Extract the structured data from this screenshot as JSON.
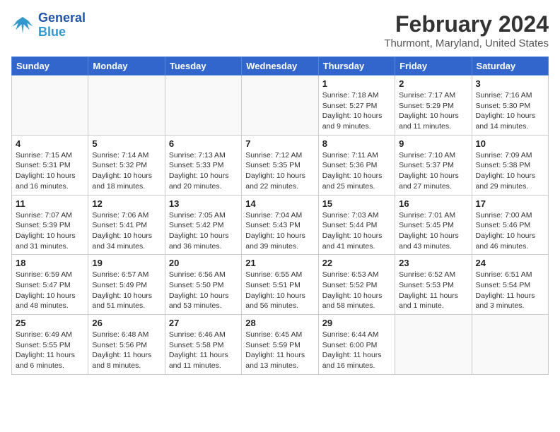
{
  "logo": {
    "text_general": "General",
    "text_blue": "Blue"
  },
  "header": {
    "month": "February 2024",
    "location": "Thurmont, Maryland, United States"
  },
  "days_of_week": [
    "Sunday",
    "Monday",
    "Tuesday",
    "Wednesday",
    "Thursday",
    "Friday",
    "Saturday"
  ],
  "weeks": [
    [
      {
        "day": "",
        "info": ""
      },
      {
        "day": "",
        "info": ""
      },
      {
        "day": "",
        "info": ""
      },
      {
        "day": "",
        "info": ""
      },
      {
        "day": "1",
        "info": "Sunrise: 7:18 AM\nSunset: 5:27 PM\nDaylight: 10 hours\nand 9 minutes."
      },
      {
        "day": "2",
        "info": "Sunrise: 7:17 AM\nSunset: 5:29 PM\nDaylight: 10 hours\nand 11 minutes."
      },
      {
        "day": "3",
        "info": "Sunrise: 7:16 AM\nSunset: 5:30 PM\nDaylight: 10 hours\nand 14 minutes."
      }
    ],
    [
      {
        "day": "4",
        "info": "Sunrise: 7:15 AM\nSunset: 5:31 PM\nDaylight: 10 hours\nand 16 minutes."
      },
      {
        "day": "5",
        "info": "Sunrise: 7:14 AM\nSunset: 5:32 PM\nDaylight: 10 hours\nand 18 minutes."
      },
      {
        "day": "6",
        "info": "Sunrise: 7:13 AM\nSunset: 5:33 PM\nDaylight: 10 hours\nand 20 minutes."
      },
      {
        "day": "7",
        "info": "Sunrise: 7:12 AM\nSunset: 5:35 PM\nDaylight: 10 hours\nand 22 minutes."
      },
      {
        "day": "8",
        "info": "Sunrise: 7:11 AM\nSunset: 5:36 PM\nDaylight: 10 hours\nand 25 minutes."
      },
      {
        "day": "9",
        "info": "Sunrise: 7:10 AM\nSunset: 5:37 PM\nDaylight: 10 hours\nand 27 minutes."
      },
      {
        "day": "10",
        "info": "Sunrise: 7:09 AM\nSunset: 5:38 PM\nDaylight: 10 hours\nand 29 minutes."
      }
    ],
    [
      {
        "day": "11",
        "info": "Sunrise: 7:07 AM\nSunset: 5:39 PM\nDaylight: 10 hours\nand 31 minutes."
      },
      {
        "day": "12",
        "info": "Sunrise: 7:06 AM\nSunset: 5:41 PM\nDaylight: 10 hours\nand 34 minutes."
      },
      {
        "day": "13",
        "info": "Sunrise: 7:05 AM\nSunset: 5:42 PM\nDaylight: 10 hours\nand 36 minutes."
      },
      {
        "day": "14",
        "info": "Sunrise: 7:04 AM\nSunset: 5:43 PM\nDaylight: 10 hours\nand 39 minutes."
      },
      {
        "day": "15",
        "info": "Sunrise: 7:03 AM\nSunset: 5:44 PM\nDaylight: 10 hours\nand 41 minutes."
      },
      {
        "day": "16",
        "info": "Sunrise: 7:01 AM\nSunset: 5:45 PM\nDaylight: 10 hours\nand 43 minutes."
      },
      {
        "day": "17",
        "info": "Sunrise: 7:00 AM\nSunset: 5:46 PM\nDaylight: 10 hours\nand 46 minutes."
      }
    ],
    [
      {
        "day": "18",
        "info": "Sunrise: 6:59 AM\nSunset: 5:47 PM\nDaylight: 10 hours\nand 48 minutes."
      },
      {
        "day": "19",
        "info": "Sunrise: 6:57 AM\nSunset: 5:49 PM\nDaylight: 10 hours\nand 51 minutes."
      },
      {
        "day": "20",
        "info": "Sunrise: 6:56 AM\nSunset: 5:50 PM\nDaylight: 10 hours\nand 53 minutes."
      },
      {
        "day": "21",
        "info": "Sunrise: 6:55 AM\nSunset: 5:51 PM\nDaylight: 10 hours\nand 56 minutes."
      },
      {
        "day": "22",
        "info": "Sunrise: 6:53 AM\nSunset: 5:52 PM\nDaylight: 10 hours\nand 58 minutes."
      },
      {
        "day": "23",
        "info": "Sunrise: 6:52 AM\nSunset: 5:53 PM\nDaylight: 11 hours\nand 1 minute."
      },
      {
        "day": "24",
        "info": "Sunrise: 6:51 AM\nSunset: 5:54 PM\nDaylight: 11 hours\nand 3 minutes."
      }
    ],
    [
      {
        "day": "25",
        "info": "Sunrise: 6:49 AM\nSunset: 5:55 PM\nDaylight: 11 hours\nand 6 minutes."
      },
      {
        "day": "26",
        "info": "Sunrise: 6:48 AM\nSunset: 5:56 PM\nDaylight: 11 hours\nand 8 minutes."
      },
      {
        "day": "27",
        "info": "Sunrise: 6:46 AM\nSunset: 5:58 PM\nDaylight: 11 hours\nand 11 minutes."
      },
      {
        "day": "28",
        "info": "Sunrise: 6:45 AM\nSunset: 5:59 PM\nDaylight: 11 hours\nand 13 minutes."
      },
      {
        "day": "29",
        "info": "Sunrise: 6:44 AM\nSunset: 6:00 PM\nDaylight: 11 hours\nand 16 minutes."
      },
      {
        "day": "",
        "info": ""
      },
      {
        "day": "",
        "info": ""
      }
    ]
  ]
}
